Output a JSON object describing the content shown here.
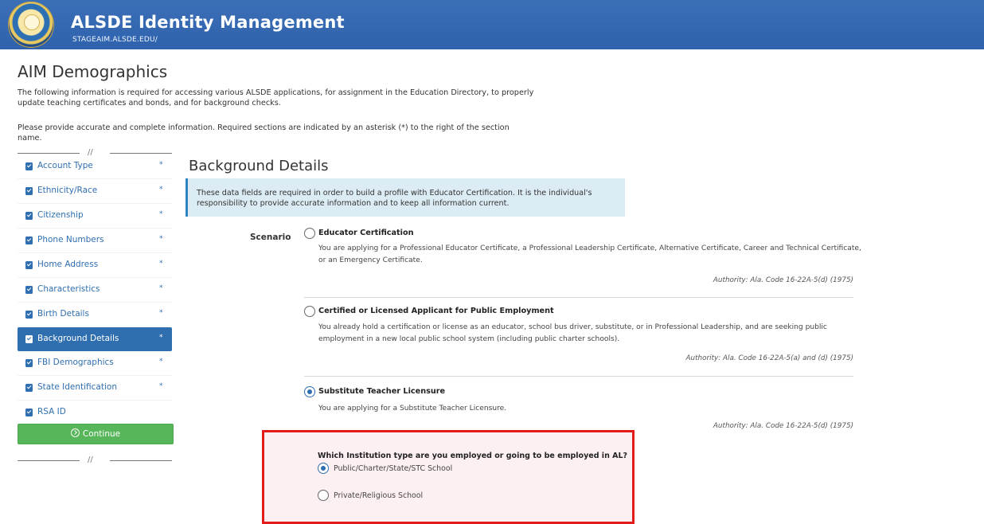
{
  "header": {
    "title": "ALSDE Identity Management",
    "subtitle": "STAGEAIM.ALSDE.EDU/"
  },
  "page": {
    "title": "AIM Demographics",
    "intro": "The following information is required for accessing various ALSDE applications, for assignment in the Education Directory, to properly update teaching certificates and bonds, and for background checks.",
    "intro2": "Please provide accurate and complete information. Required sections are indicated by an asterisk (*) to the right of the section name.",
    "divider": "//"
  },
  "sidebar": {
    "items": [
      {
        "label": "Account Type",
        "required": "*"
      },
      {
        "label": "Ethnicity/Race",
        "required": "*"
      },
      {
        "label": "Citizenship",
        "required": "*"
      },
      {
        "label": "Phone Numbers",
        "required": "*"
      },
      {
        "label": "Home Address",
        "required": "*"
      },
      {
        "label": "Characteristics",
        "required": "*"
      },
      {
        "label": "Birth Details",
        "required": "*"
      },
      {
        "label": "Background Details",
        "required": "*"
      },
      {
        "label": "FBI Demographics",
        "required": "*"
      },
      {
        "label": "State Identification",
        "required": "*"
      },
      {
        "label": "RSA ID",
        "required": ""
      }
    ],
    "continue_label": "Continue"
  },
  "main": {
    "title": "Background Details",
    "info": "These data fields are required in order to build a profile with Educator Certification. It is the individual's responsibility to provide accurate information and to keep all information current.",
    "scenario_label": "Scenario",
    "options": [
      {
        "title": "Educator Certification",
        "description": "You are applying for a Professional Educator Certificate, a Professional Leadership Certificate, Alternative Certificate, Career and Technical Certificate, or an Emergency Certificate.",
        "authority": "Authority: Ala. Code 16-22A-5(d) (1975)",
        "selected": false
      },
      {
        "title": "Certified or Licensed Applicant for Public Employment",
        "description": "You already hold a certification or license as an educator, school bus driver, substitute, or in Professional Leadership, and are seeking public employment in a new local public school system (including public charter schools).",
        "authority": "Authority: Ala. Code 16-22A-5(a) and (d) (1975)",
        "selected": false
      },
      {
        "title": "Substitute Teacher Licensure",
        "description": "You are applying for a Substitute Teacher Licensure.",
        "authority": "Authority: Ala. Code 16-22A-5(d) (1975)",
        "selected": true
      }
    ],
    "institution_question": "Which Institution type are you employed or going to be employed in AL?",
    "institution_choices": [
      {
        "label": "Public/Charter/State/STC School",
        "selected": true
      },
      {
        "label": "Private/Religious School",
        "selected": false
      }
    ]
  },
  "colors": {
    "header_blue": "#2f62ad",
    "nav_blue": "#2f6fb0",
    "continue_green": "#58b65a",
    "highlight_red": "#e21b1b",
    "info_bg": "#dcecf4"
  }
}
